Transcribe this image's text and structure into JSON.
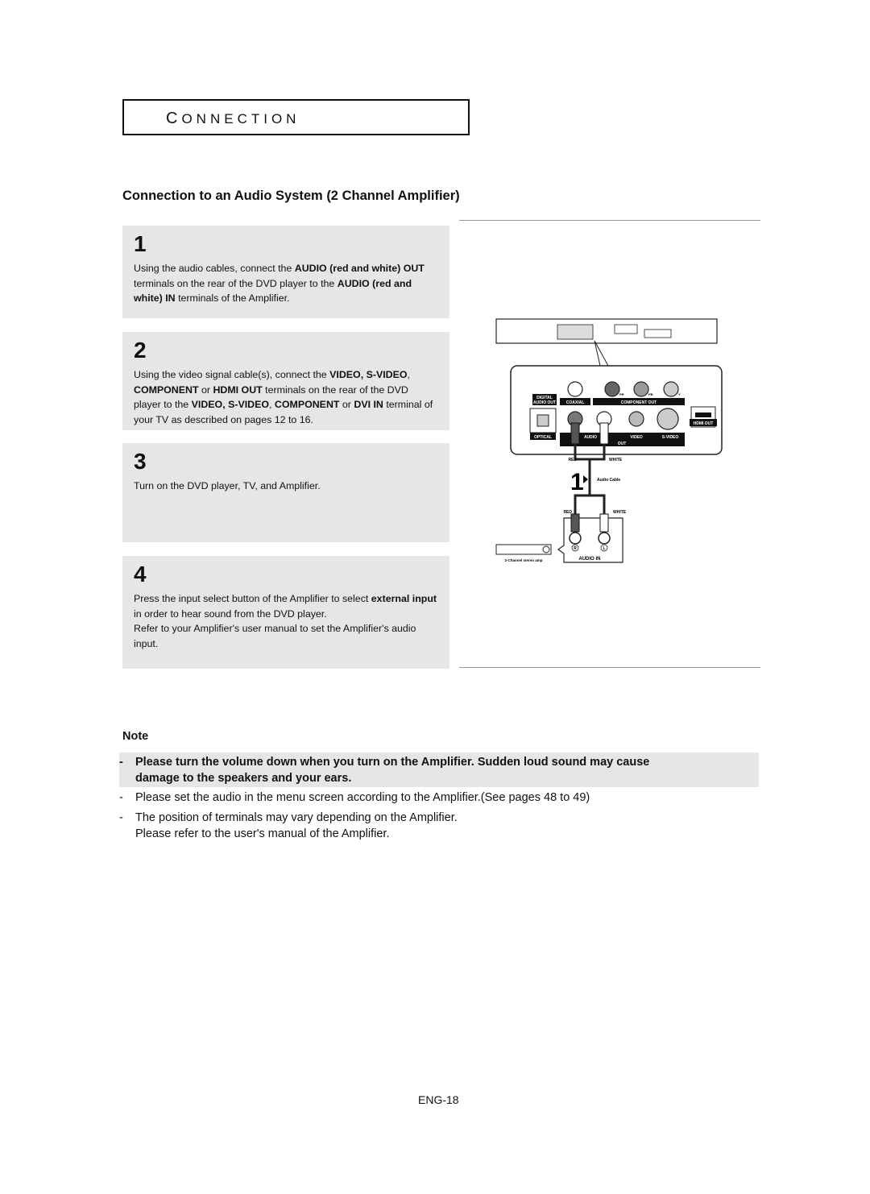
{
  "header": {
    "section": "CONNECTION"
  },
  "heading": "Connection to an Audio System (2 Channel Amplifier)",
  "steps": [
    {
      "num": "1",
      "segments": [
        {
          "t": "Using the audio cables, connect the ",
          "b": false
        },
        {
          "t": "AUDIO (red and white) OUT",
          "b": true
        },
        {
          "t": " terminals on the rear of the DVD player to the ",
          "b": false
        },
        {
          "t": "AUDIO (red and white) IN",
          "b": true
        },
        {
          "t": " terminals of the Amplifier.",
          "b": false
        }
      ]
    },
    {
      "num": "2",
      "segments": [
        {
          "t": "Using the video signal cable(s), connect the ",
          "b": false
        },
        {
          "t": "VIDEO, S-VIDEO",
          "b": true
        },
        {
          "t": ", ",
          "b": false
        },
        {
          "t": "COMPONENT",
          "b": true
        },
        {
          "t": " or ",
          "b": false
        },
        {
          "t": "HDMI OUT",
          "b": true
        },
        {
          "t": " terminals on the rear of the DVD player to the ",
          "b": false
        },
        {
          "t": "VIDEO, S-VIDEO",
          "b": true
        },
        {
          "t": ", ",
          "b": false
        },
        {
          "t": "COMPONENT",
          "b": true
        },
        {
          "t": " or ",
          "b": false
        },
        {
          "t": "DVI IN",
          "b": true
        },
        {
          "t": " terminal of your TV as described on pages 12 to 16.",
          "b": false
        }
      ]
    },
    {
      "num": "3",
      "segments": [
        {
          "t": "Turn on the DVD player, TV, and Amplifier.",
          "b": false
        }
      ]
    },
    {
      "num": "4",
      "segments": [
        {
          "t": "Press the input select button of the Amplifier to select ",
          "b": false
        },
        {
          "t": "external input",
          "b": true
        },
        {
          "t": "  in order to hear sound from the DVD player.",
          "b": false
        },
        {
          "t": "\nRefer to your Amplifier's user manual to set the Amplifier's audio input.",
          "b": false
        }
      ]
    }
  ],
  "diagram": {
    "digital_audio_out": [
      "DIGITAL",
      "AUDIO OUT"
    ],
    "coaxial": "COAXIAL",
    "component_out": "COMPONENT OUT",
    "pr": "PR",
    "pb": "PB",
    "y": "Y",
    "optical": "OPTICAL",
    "audio": "AUDIO",
    "video": "VIDEO",
    "s_video": "S-VIDEO",
    "out": "OUT",
    "hdmi_out": "HDMI OUT",
    "red": "RED",
    "white": "WHITE",
    "step_marker": "1",
    "cable": "Audio Cable",
    "r": "R",
    "l": "L",
    "audio_in": "AUDIO IN",
    "amp": "2-Channel stereo amp",
    "colors": {
      "red_plug": "#555555",
      "white_plug": "#ffffff"
    }
  },
  "note": {
    "title": "Note",
    "items": [
      {
        "dash": "-",
        "lines": [
          "Please turn the volume down when you turn on the Amplifier. Sudden loud sound may cause",
          "damage to the speakers and your ears."
        ],
        "bold": true
      },
      {
        "dash": "-",
        "lines": [
          "Please set the audio in the menu screen according to the Amplifier.(See pages 48 to 49)"
        ],
        "bold": false
      },
      {
        "dash": "-",
        "lines": [
          "The position of terminals may vary depending on the Amplifier.",
          "Please refer to the user's manual of the Amplifier."
        ],
        "bold": false
      }
    ]
  },
  "footer": {
    "page": "ENG-18"
  }
}
